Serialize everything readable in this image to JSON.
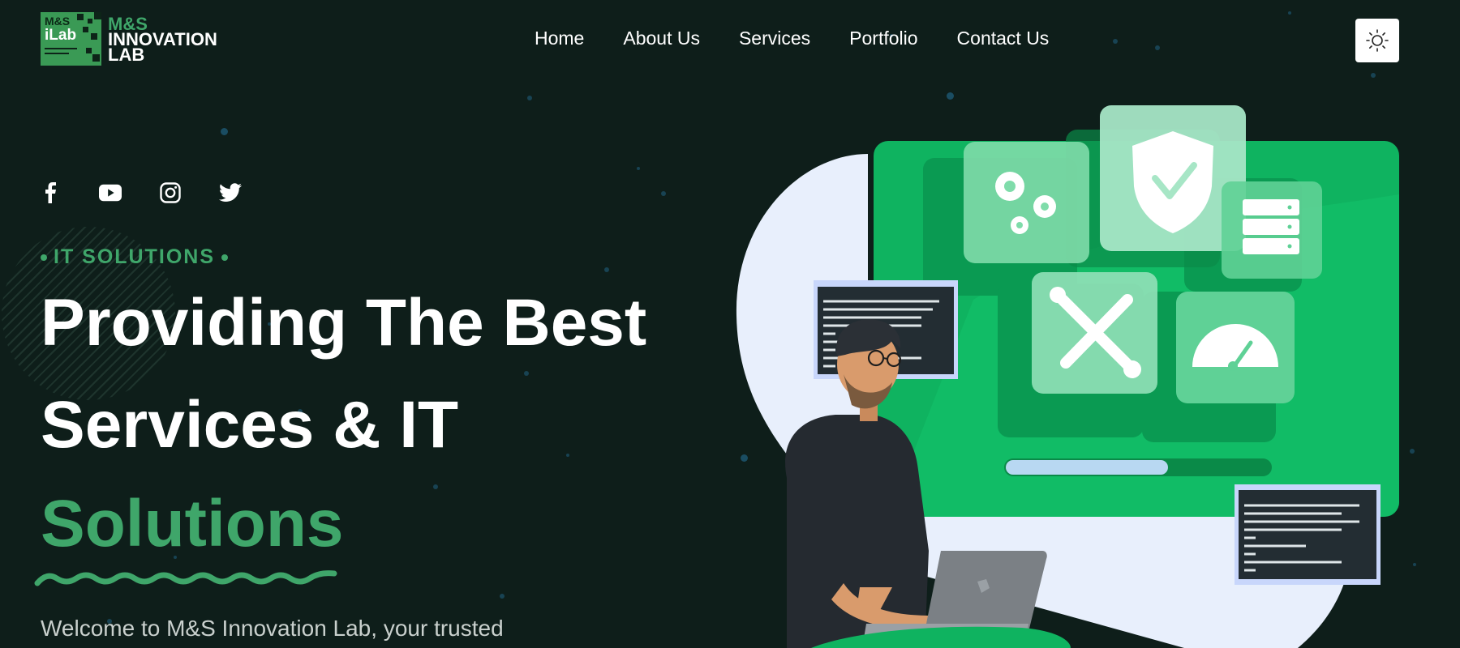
{
  "header": {
    "logo": {
      "badge_line1": "M&S",
      "badge_line2": "iLab",
      "line1": "M&S",
      "line2": "INNOVATION",
      "line3": "LAB"
    },
    "nav": [
      {
        "label": "Home"
      },
      {
        "label": "About Us"
      },
      {
        "label": "Services"
      },
      {
        "label": "Portfolio"
      },
      {
        "label": "Contact Us"
      }
    ],
    "theme_toggle_icon": "sun-icon"
  },
  "social": [
    "facebook-icon",
    "youtube-icon",
    "instagram-icon",
    "twitter-icon"
  ],
  "hero": {
    "tag": "IT SOLUTIONS",
    "title_line1": "Providing The Best",
    "title_line2": "Services & IT",
    "title_line3": "Solutions",
    "welcome": "Welcome to M&S Innovation Lab, your trusted"
  },
  "colors": {
    "background": "#0e1e1a",
    "accent_green": "#3fa66a",
    "illustration_green": "#0fb360",
    "white": "#ffffff"
  }
}
